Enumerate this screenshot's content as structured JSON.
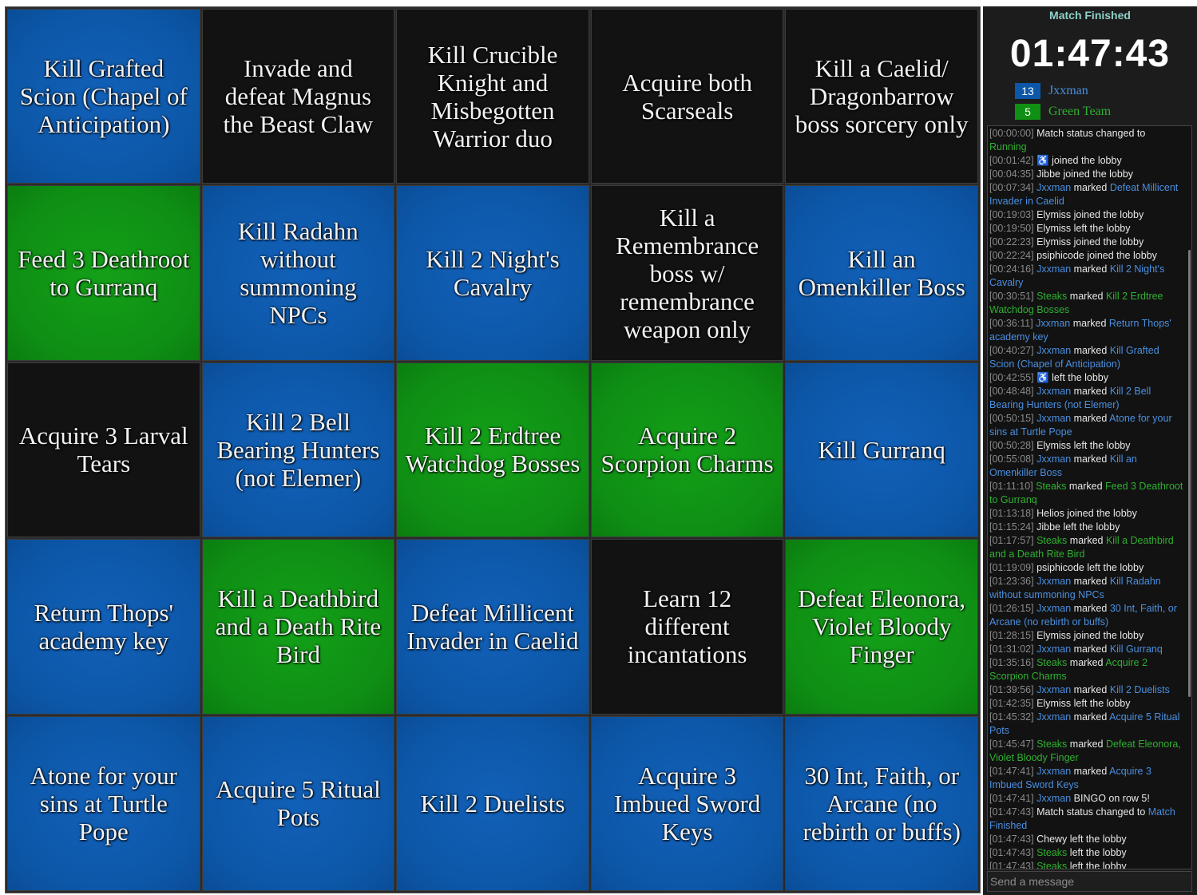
{
  "colors": {
    "blue": "#0d57a8",
    "green": "#0f8f14",
    "black": "#121212"
  },
  "board": [
    {
      "text": "Kill Grafted Scion (Chapel of Anticipation)",
      "color": "blue"
    },
    {
      "text": "Invade and defeat Magnus the Beast Claw",
      "color": "black"
    },
    {
      "text": "Kill Crucible Knight and Misbegotten Warrior duo",
      "color": "black"
    },
    {
      "text": "Acquire both Scarseals",
      "color": "black"
    },
    {
      "text": "Kill a Caelid/ Dragonbarrow boss sorcery only",
      "color": "black"
    },
    {
      "text": "Feed 3 Deathroot to Gurranq",
      "color": "green"
    },
    {
      "text": "Kill Radahn without summoning NPCs",
      "color": "blue"
    },
    {
      "text": "Kill 2 Night's Cavalry",
      "color": "blue"
    },
    {
      "text": "Kill a Remembrance boss w/ remembrance weapon only",
      "color": "black"
    },
    {
      "text": "Kill an Omenkiller Boss",
      "color": "blue"
    },
    {
      "text": "Acquire 3 Larval Tears",
      "color": "black"
    },
    {
      "text": "Kill 2 Bell Bearing Hunters (not Elemer)",
      "color": "blue"
    },
    {
      "text": "Kill 2 Erdtree Watchdog Bosses",
      "color": "green"
    },
    {
      "text": "Acquire 2 Scorpion Charms",
      "color": "green"
    },
    {
      "text": "Kill Gurranq",
      "color": "blue"
    },
    {
      "text": "Return Thops' academy key",
      "color": "blue"
    },
    {
      "text": "Kill a Deathbird and a Death Rite Bird",
      "color": "green"
    },
    {
      "text": "Defeat Millicent Invader in Caelid",
      "color": "blue"
    },
    {
      "text": "Learn 12 different incantations",
      "color": "black"
    },
    {
      "text": "Defeat Eleonora, Violet Bloody Finger",
      "color": "green"
    },
    {
      "text": "Atone for your sins at Turtle Pope",
      "color": "blue"
    },
    {
      "text": "Acquire 5 Ritual Pots",
      "color": "blue"
    },
    {
      "text": "Kill 2 Duelists",
      "color": "blue"
    },
    {
      "text": "Acquire 3 Imbued Sword Keys",
      "color": "blue"
    },
    {
      "text": "30 Int, Faith, or Arcane (no rebirth or buffs)",
      "color": "blue"
    }
  ],
  "sidebar": {
    "status": "Match Finished",
    "timer": "01:47:43",
    "teams": [
      {
        "count": "13",
        "name": "Jxxman",
        "color": "blue"
      },
      {
        "count": "5",
        "name": "Green Team",
        "color": "green"
      }
    ],
    "chat_placeholder": "Send a message"
  },
  "log": [
    {
      "time": "[00:00:00]",
      "parts": [
        {
          "t": "Match status changed to "
        },
        {
          "t": "Running",
          "c": "green"
        }
      ]
    },
    {
      "time": "[00:01:42]",
      "parts": [
        {
          "t": "♿ joined the lobby"
        }
      ]
    },
    {
      "time": "[00:04:35]",
      "parts": [
        {
          "t": "Jibbe joined the lobby"
        }
      ]
    },
    {
      "time": "[00:07:34]",
      "parts": [
        {
          "t": "Jxxman",
          "c": "blue"
        },
        {
          "t": " marked "
        },
        {
          "t": "Defeat Millicent Invader in Caelid",
          "c": "blue"
        }
      ]
    },
    {
      "time": "[00:19:03]",
      "parts": [
        {
          "t": "Elymiss joined the lobby"
        }
      ]
    },
    {
      "time": "[00:19:50]",
      "parts": [
        {
          "t": "Elymiss left the lobby"
        }
      ]
    },
    {
      "time": "[00:22:23]",
      "parts": [
        {
          "t": "Elymiss joined the lobby"
        }
      ]
    },
    {
      "time": "[00:22:24]",
      "parts": [
        {
          "t": "psiphicode joined the lobby"
        }
      ]
    },
    {
      "time": "[00:24:16]",
      "parts": [
        {
          "t": "Jxxman",
          "c": "blue"
        },
        {
          "t": " marked "
        },
        {
          "t": "Kill 2 Night's Cavalry",
          "c": "blue"
        }
      ]
    },
    {
      "time": "[00:30:51]",
      "parts": [
        {
          "t": "Steaks",
          "c": "green"
        },
        {
          "t": " marked "
        },
        {
          "t": "Kill 2 Erdtree Watchdog Bosses",
          "c": "green"
        }
      ]
    },
    {
      "time": "[00:36:11]",
      "parts": [
        {
          "t": "Jxxman",
          "c": "blue"
        },
        {
          "t": " marked "
        },
        {
          "t": "Return Thops' academy key",
          "c": "blue"
        }
      ]
    },
    {
      "time": "[00:40:27]",
      "parts": [
        {
          "t": "Jxxman",
          "c": "blue"
        },
        {
          "t": " marked "
        },
        {
          "t": "Kill Grafted Scion (Chapel of Anticipation)",
          "c": "blue"
        }
      ]
    },
    {
      "time": "[00:42:55]",
      "parts": [
        {
          "t": "♿ left the lobby"
        }
      ]
    },
    {
      "time": "[00:48:48]",
      "parts": [
        {
          "t": "Jxxman",
          "c": "blue"
        },
        {
          "t": " marked "
        },
        {
          "t": "Kill 2 Bell Bearing Hunters (not Elemer)",
          "c": "blue"
        }
      ]
    },
    {
      "time": "[00:50:15]",
      "parts": [
        {
          "t": "Jxxman",
          "c": "blue"
        },
        {
          "t": " marked "
        },
        {
          "t": "Atone for your sins at Turtle Pope",
          "c": "blue"
        }
      ]
    },
    {
      "time": "[00:50:28]",
      "parts": [
        {
          "t": "Elymiss left the lobby"
        }
      ]
    },
    {
      "time": "[00:55:08]",
      "parts": [
        {
          "t": "Jxxman",
          "c": "blue"
        },
        {
          "t": " marked "
        },
        {
          "t": "Kill an Omenkiller Boss",
          "c": "blue"
        }
      ]
    },
    {
      "time": "[01:11:10]",
      "parts": [
        {
          "t": "Steaks",
          "c": "green"
        },
        {
          "t": " marked "
        },
        {
          "t": "Feed 3 Deathroot to Gurranq",
          "c": "green"
        }
      ]
    },
    {
      "time": "[01:13:18]",
      "parts": [
        {
          "t": "Helios joined the lobby"
        }
      ]
    },
    {
      "time": "[01:15:24]",
      "parts": [
        {
          "t": "Jibbe left the lobby"
        }
      ]
    },
    {
      "time": "[01:17:57]",
      "parts": [
        {
          "t": "Steaks",
          "c": "green"
        },
        {
          "t": " marked "
        },
        {
          "t": "Kill a Deathbird and a Death Rite Bird",
          "c": "green"
        }
      ]
    },
    {
      "time": "[01:19:09]",
      "parts": [
        {
          "t": "psiphicode left the lobby"
        }
      ]
    },
    {
      "time": "[01:23:36]",
      "parts": [
        {
          "t": "Jxxman",
          "c": "blue"
        },
        {
          "t": " marked "
        },
        {
          "t": "Kill Radahn without summoning NPCs",
          "c": "blue"
        }
      ]
    },
    {
      "time": "[01:26:15]",
      "parts": [
        {
          "t": "Jxxman",
          "c": "blue"
        },
        {
          "t": " marked "
        },
        {
          "t": "30 Int, Faith, or Arcane (no rebirth or buffs)",
          "c": "blue"
        }
      ]
    },
    {
      "time": "[01:28:15]",
      "parts": [
        {
          "t": "Elymiss joined the lobby"
        }
      ]
    },
    {
      "time": "[01:31:02]",
      "parts": [
        {
          "t": "Jxxman",
          "c": "blue"
        },
        {
          "t": " marked "
        },
        {
          "t": "Kill Gurranq",
          "c": "blue"
        }
      ]
    },
    {
      "time": "[01:35:16]",
      "parts": [
        {
          "t": "Steaks",
          "c": "green"
        },
        {
          "t": " marked "
        },
        {
          "t": "Acquire 2 Scorpion Charms",
          "c": "green"
        }
      ]
    },
    {
      "time": "[01:39:56]",
      "parts": [
        {
          "t": "Jxxman",
          "c": "blue"
        },
        {
          "t": " marked "
        },
        {
          "t": "Kill 2 Duelists",
          "c": "blue"
        }
      ]
    },
    {
      "time": "[01:42:35]",
      "parts": [
        {
          "t": "Elymiss left the lobby"
        }
      ]
    },
    {
      "time": "[01:45:32]",
      "parts": [
        {
          "t": "Jxxman",
          "c": "blue"
        },
        {
          "t": " marked "
        },
        {
          "t": "Acquire 5 Ritual Pots",
          "c": "blue"
        }
      ]
    },
    {
      "time": "[01:45:47]",
      "parts": [
        {
          "t": "Steaks",
          "c": "green"
        },
        {
          "t": " marked "
        },
        {
          "t": "Defeat Eleonora, Violet Bloody Finger",
          "c": "green"
        }
      ]
    },
    {
      "time": "[01:47:41]",
      "parts": [
        {
          "t": "Jxxman",
          "c": "blue"
        },
        {
          "t": " marked "
        },
        {
          "t": "Acquire 3 Imbued Sword Keys",
          "c": "blue"
        }
      ]
    },
    {
      "time": "[01:47:41]",
      "parts": [
        {
          "t": "Jxxman",
          "c": "blue"
        },
        {
          "t": " BINGO on row 5!"
        }
      ]
    },
    {
      "time": "[01:47:43]",
      "parts": [
        {
          "t": "Match status changed to "
        },
        {
          "t": "Match Finished",
          "c": "blue"
        }
      ]
    },
    {
      "time": "[01:47:43]",
      "parts": [
        {
          "t": "Chewy left the lobby"
        }
      ]
    },
    {
      "time": "[01:47:43]",
      "parts": [
        {
          "t": "Steaks",
          "c": "green"
        },
        {
          "t": " left the lobby"
        }
      ]
    },
    {
      "time": "[01:47:43]",
      "parts": [
        {
          "t": "Steaks",
          "c": "green"
        },
        {
          "t": " left the lobby"
        }
      ]
    }
  ]
}
